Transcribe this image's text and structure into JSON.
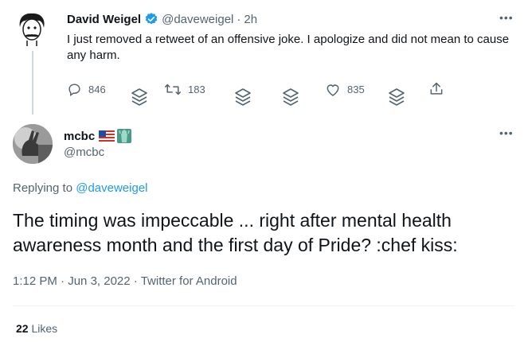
{
  "quoted_tweet": {
    "author_name": "David Weigel",
    "handle": "@daveweigel",
    "separator": "·",
    "time": "2h",
    "text": "I just removed a retweet of an offensive joke. I apologize and did not mean to cause any harm.",
    "reply_count": "846",
    "retweet_count": "183",
    "like_count": "835",
    "verified_color": "#1d9bf0"
  },
  "reply_tweet": {
    "author_name": "mcbc",
    "handle": "@mcbc",
    "name_emojis": [
      "flag-us-icon",
      "statue-of-liberty-icon"
    ],
    "replying_prefix": "Replying to",
    "replying_to": "@daveweigel",
    "text": "The timing was impeccable ... right after mental health awareness month and the first day of Pride? :chef kiss:",
    "time": "1:12 PM",
    "date": "Jun 3, 2022",
    "source": "Twitter for Android",
    "likes_count": "22",
    "likes_label": "Likes"
  },
  "colors": {
    "accent": "#1d9bf0",
    "text_primary": "#0f1419",
    "text_secondary": "#536471",
    "border": "#eff3f4"
  }
}
